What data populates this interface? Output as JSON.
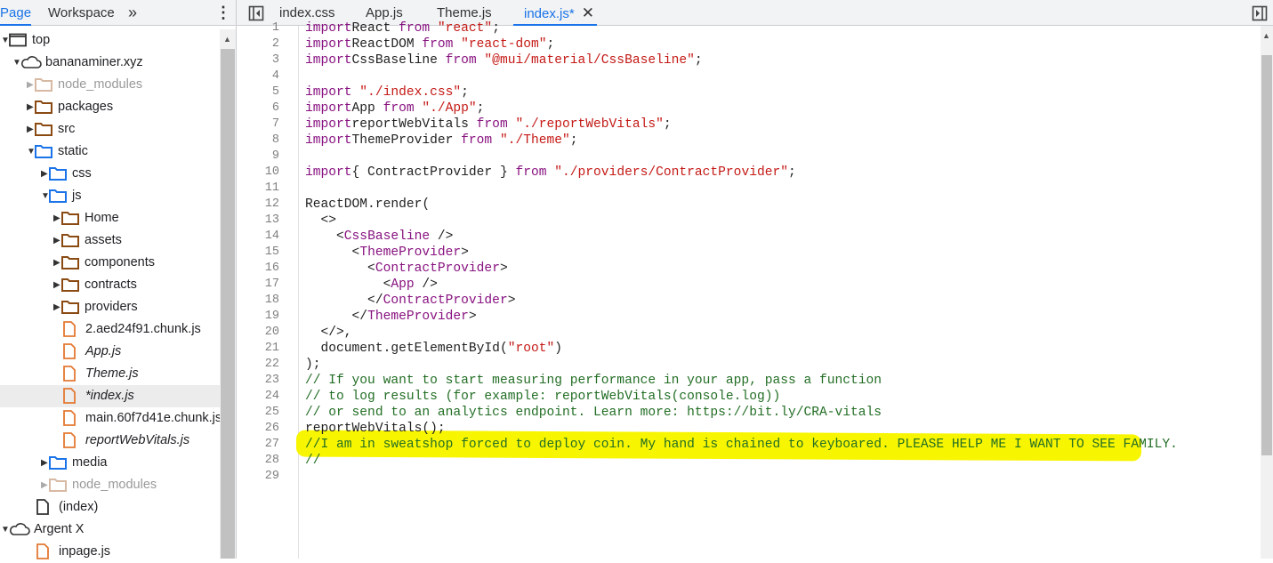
{
  "left_tabs": [
    {
      "label": "Page",
      "active": true
    },
    {
      "label": "Workspace",
      "active": false
    }
  ],
  "more_icon": "chevron-double-right-icon",
  "menu_icon": "kebab-menu-icon",
  "editor_tabs": [
    {
      "label": "index.css"
    },
    {
      "label": "App.js"
    },
    {
      "label": "Theme.js"
    },
    {
      "label": "index.js*",
      "active": true
    }
  ],
  "tree": [
    {
      "label": "top",
      "depth": 0,
      "icon": "frame",
      "open": true
    },
    {
      "label": "bananaminer.xyz",
      "depth": 1,
      "icon": "cloud",
      "open": true
    },
    {
      "label": "node_modules",
      "depth": 2,
      "icon": "folder-faded",
      "open": false,
      "gray": true
    },
    {
      "label": "packages",
      "depth": 2,
      "icon": "folder-brown",
      "open": false
    },
    {
      "label": "src",
      "depth": 2,
      "icon": "folder-brown",
      "open": false
    },
    {
      "label": "static",
      "depth": 2,
      "icon": "folder-blue",
      "open": true
    },
    {
      "label": "css",
      "depth": 3,
      "icon": "folder-blue",
      "open": false
    },
    {
      "label": "js",
      "depth": 3,
      "icon": "folder-blue",
      "open": true
    },
    {
      "label": "Home",
      "depth": 4,
      "icon": "folder-brown",
      "open": false
    },
    {
      "label": "assets",
      "depth": 4,
      "icon": "folder-brown",
      "open": false
    },
    {
      "label": "components",
      "depth": 4,
      "icon": "folder-brown",
      "open": false
    },
    {
      "label": "contracts",
      "depth": 4,
      "icon": "folder-brown",
      "open": false
    },
    {
      "label": "providers",
      "depth": 4,
      "icon": "folder-brown",
      "open": false
    },
    {
      "label": "2.aed24f91.chunk.js",
      "depth": 4,
      "icon": "file-orange"
    },
    {
      "label": "App.js",
      "depth": 4,
      "icon": "file-orange",
      "italic": true
    },
    {
      "label": "Theme.js",
      "depth": 4,
      "icon": "file-orange",
      "italic": true
    },
    {
      "label": "*index.js",
      "depth": 4,
      "icon": "file-orange",
      "italic": true,
      "selected": true
    },
    {
      "label": "main.60f7d41e.chunk.js",
      "depth": 4,
      "icon": "file-orange"
    },
    {
      "label": "reportWebVitals.js",
      "depth": 4,
      "icon": "file-orange",
      "italic": true
    },
    {
      "label": "media",
      "depth": 3,
      "icon": "folder-blue",
      "open": false
    },
    {
      "label": "node_modules",
      "depth": 3,
      "icon": "folder-faded",
      "open": false,
      "gray": true
    },
    {
      "label": "(index)",
      "depth": 2,
      "icon": "file-plain"
    },
    {
      "label": "Argent X",
      "depth": 0,
      "icon": "cloud",
      "open": true
    },
    {
      "label": "inpage.js",
      "depth": 2,
      "icon": "file-orange"
    }
  ],
  "code_lines": [
    [
      [
        "kw",
        "import"
      ],
      [
        "",
        "React "
      ],
      [
        "kw",
        "from"
      ],
      [
        "str",
        " \"react\""
      ],
      [
        "",
        ";"
      ]
    ],
    [
      [
        "kw",
        "import"
      ],
      [
        "",
        "ReactDOM "
      ],
      [
        "kw",
        "from"
      ],
      [
        "str",
        " \"react-dom\""
      ],
      [
        "",
        ";"
      ]
    ],
    [
      [
        "kw",
        "import"
      ],
      [
        "",
        "CssBaseline "
      ],
      [
        "kw",
        "from"
      ],
      [
        "str",
        " \"@mui/material/CssBaseline\""
      ],
      [
        "",
        ";"
      ]
    ],
    [],
    [
      [
        "kw",
        "import"
      ],
      [
        "str",
        " \"./index.css\""
      ],
      [
        "",
        ";"
      ]
    ],
    [
      [
        "kw",
        "import"
      ],
      [
        "",
        "App "
      ],
      [
        "kw",
        "from"
      ],
      [
        "str",
        " \"./App\""
      ],
      [
        "",
        ";"
      ]
    ],
    [
      [
        "kw",
        "import"
      ],
      [
        "",
        "reportWebVitals "
      ],
      [
        "kw",
        "from"
      ],
      [
        "str",
        " \"./reportWebVitals\""
      ],
      [
        "",
        ";"
      ]
    ],
    [
      [
        "kw",
        "import"
      ],
      [
        "",
        "ThemeProvider "
      ],
      [
        "kw",
        "from"
      ],
      [
        "str",
        " \"./Theme\""
      ],
      [
        "",
        ";"
      ]
    ],
    [],
    [
      [
        "kw",
        "import"
      ],
      [
        "",
        "",
        " "
      ],
      [
        "",
        "{ ContractProvider } "
      ],
      [
        "kw",
        "from"
      ],
      [
        "str",
        " \"./providers/ContractProvider\""
      ],
      [
        "",
        ";"
      ]
    ],
    [],
    [
      [
        "",
        "ReactDOM.render("
      ]
    ],
    [
      [
        "",
        "  <>"
      ]
    ],
    [
      [
        "",
        "    <"
      ],
      [
        "tag",
        "CssBaseline"
      ],
      [
        "",
        " />"
      ]
    ],
    [
      [
        "",
        "      <"
      ],
      [
        "tag",
        "ThemeProvider"
      ],
      [
        "",
        ">"
      ]
    ],
    [
      [
        "",
        "        <"
      ],
      [
        "tag",
        "ContractProvider"
      ],
      [
        "",
        ">"
      ]
    ],
    [
      [
        "",
        "          <"
      ],
      [
        "tag",
        "App"
      ],
      [
        "",
        " />"
      ]
    ],
    [
      [
        "",
        "        </"
      ],
      [
        "tag",
        "ContractProvider"
      ],
      [
        "",
        ">"
      ]
    ],
    [
      [
        "",
        "      </"
      ],
      [
        "tag",
        "ThemeProvider"
      ],
      [
        "",
        ">"
      ]
    ],
    [
      [
        "",
        "  </>,"
      ]
    ],
    [
      [
        "",
        "  document.getElementById("
      ],
      [
        "str",
        "\"root\""
      ],
      [
        "",
        ")"
      ]
    ],
    [
      [
        "",
        ");"
      ]
    ],
    [
      [
        "cm",
        "// If you want to start measuring performance in your app, pass a function"
      ]
    ],
    [
      [
        "cm",
        "// to log results (for example: reportWebVitals(console.log))"
      ]
    ],
    [
      [
        "cm",
        "// or send to an analytics endpoint. Learn more: https://bit.ly/CRA-vitals"
      ]
    ],
    [
      [
        "",
        "reportWebVitals();"
      ]
    ],
    [
      [
        "cm",
        "//I am in sweatshop forced to deploy coin. My hand is chained to keyboared. PLEASE HELP ME I WANT TO SEE FAMILY."
      ]
    ],
    [
      [
        "cm",
        "//"
      ]
    ],
    []
  ],
  "highlighted_line": 27,
  "colors": {
    "accent": "#1a73e8",
    "highlight": "#f8f500",
    "keyword": "#881280",
    "string": "#c41a16",
    "comment": "#236e25"
  }
}
